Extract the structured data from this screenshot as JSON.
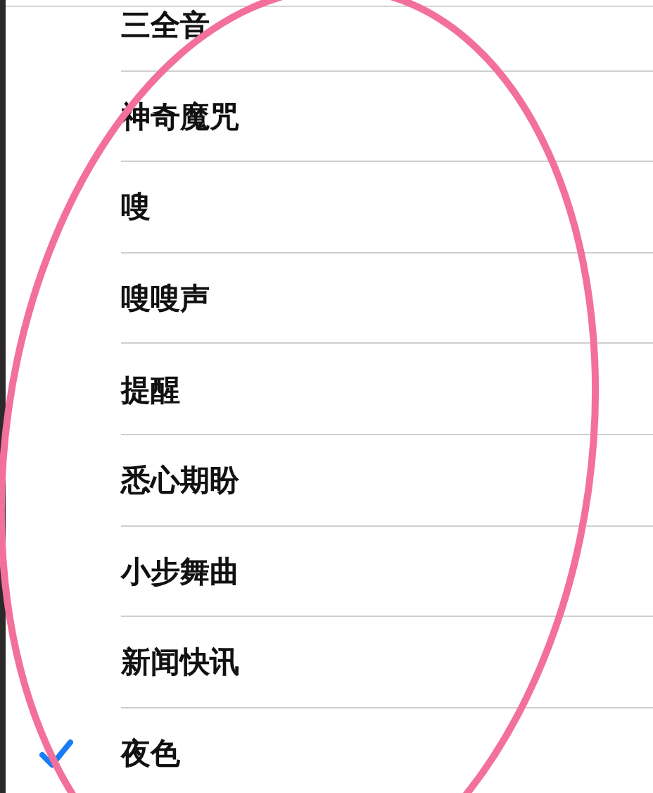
{
  "ringtones": [
    {
      "label": "三全音",
      "selected": false
    },
    {
      "label": "神奇魔咒",
      "selected": false
    },
    {
      "label": "嗖",
      "selected": false
    },
    {
      "label": "嗖嗖声",
      "selected": false
    },
    {
      "label": "提醒",
      "selected": false
    },
    {
      "label": "悉心期盼",
      "selected": false
    },
    {
      "label": "小步舞曲",
      "selected": false
    },
    {
      "label": "新闻快讯",
      "selected": false
    },
    {
      "label": "夜色",
      "selected": true
    }
  ]
}
